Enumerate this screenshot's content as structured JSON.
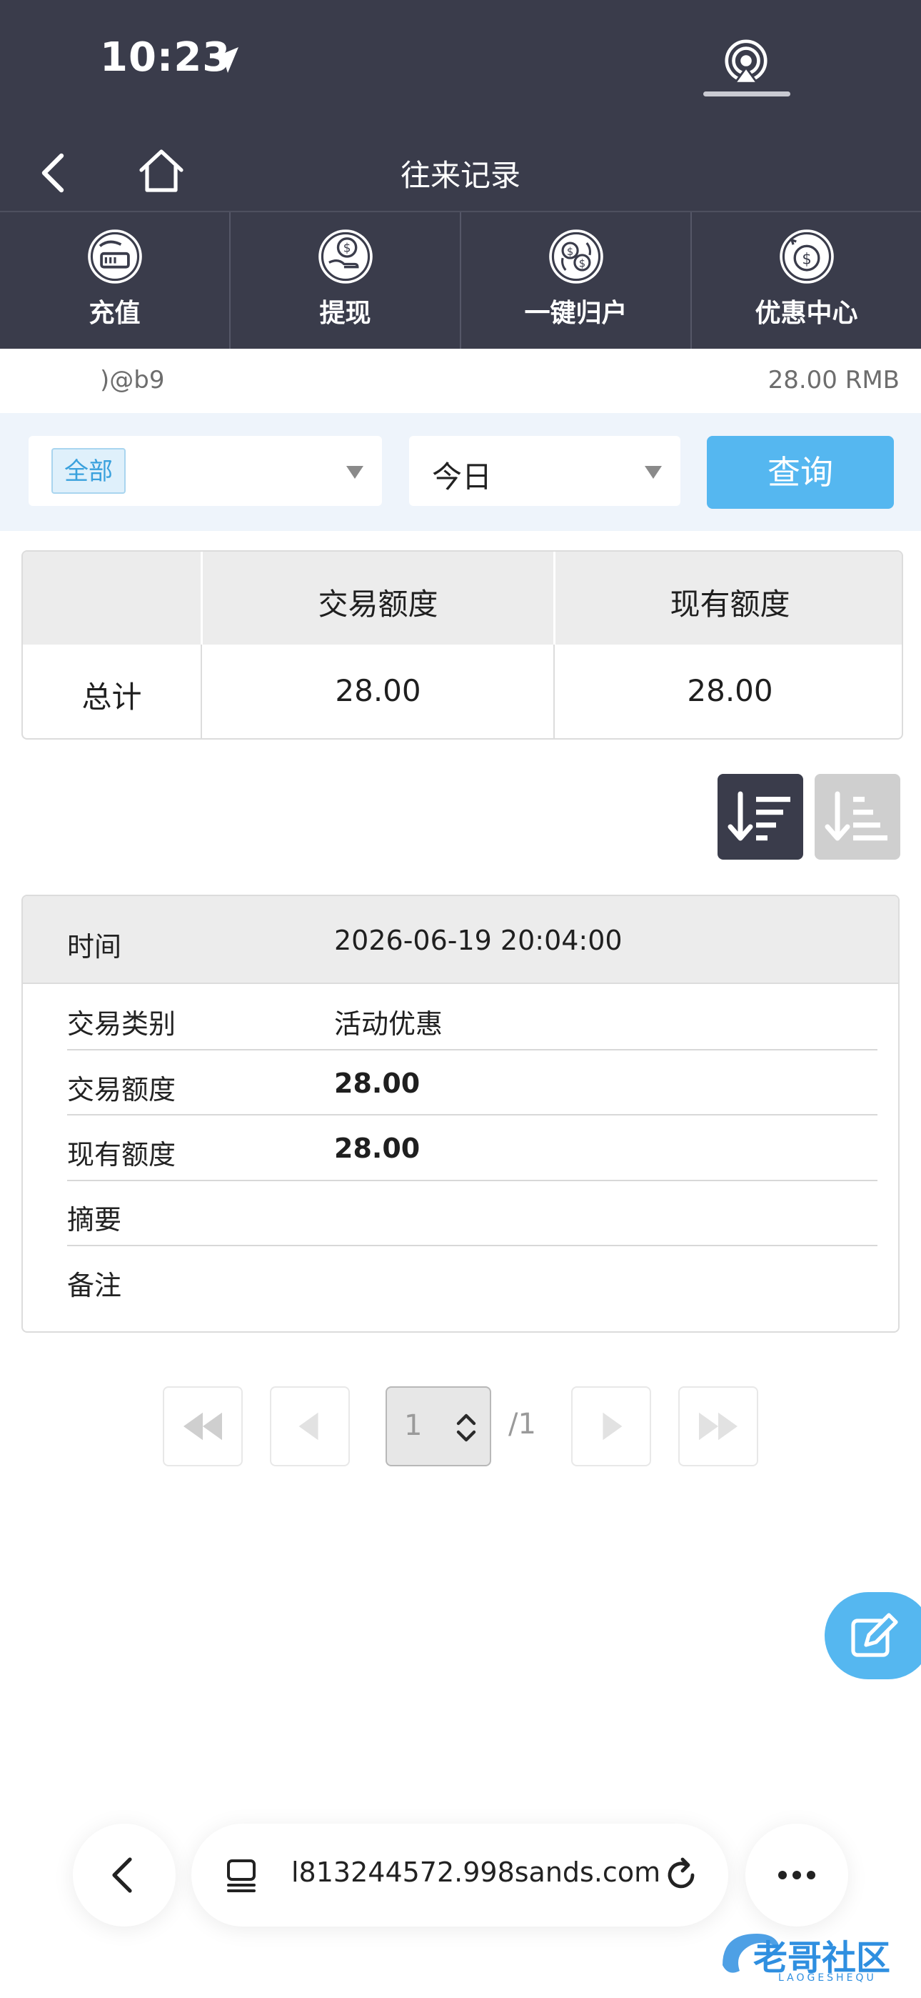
{
  "status_bar": {
    "time": "10:23"
  },
  "header": {
    "title": "往来记录"
  },
  "tabs": [
    {
      "label": "充值",
      "icon": "deposit-icon"
    },
    {
      "label": "提现",
      "icon": "withdraw-icon"
    },
    {
      "label": "一键归户",
      "icon": "transfer-icon"
    },
    {
      "label": "优惠中心",
      "icon": "promo-icon"
    }
  ],
  "account": {
    "name": ")@b9",
    "balance": "28.00 RMB"
  },
  "filters": {
    "type_selected": "全部",
    "date_selected": "今日",
    "query_label": "查询"
  },
  "summary": {
    "headers": [
      "",
      "交易额度",
      "现有额度"
    ],
    "row_label": "总计",
    "trade_amount": "28.00",
    "current_amount": "28.00"
  },
  "record": {
    "time_label": "时间",
    "time_value": "2026-06-19 20:04:00",
    "rows": [
      {
        "label": "交易类别",
        "value": "活动优惠"
      },
      {
        "label": "交易额度",
        "value": "28.00"
      },
      {
        "label": "现有额度",
        "value": "28.00"
      },
      {
        "label": "摘要",
        "value": ""
      },
      {
        "label": "备注",
        "value": ""
      }
    ]
  },
  "pagination": {
    "current_page": "1",
    "total": "/1"
  },
  "browser": {
    "url": "l813244572.998sands.com"
  },
  "watermark": {
    "text": "老哥社区",
    "sub": "LAOGESHEQU"
  },
  "colors": {
    "header_bg": "#3a3c4b",
    "accent": "#55b7f0",
    "filter_bg": "#eef4fb"
  }
}
